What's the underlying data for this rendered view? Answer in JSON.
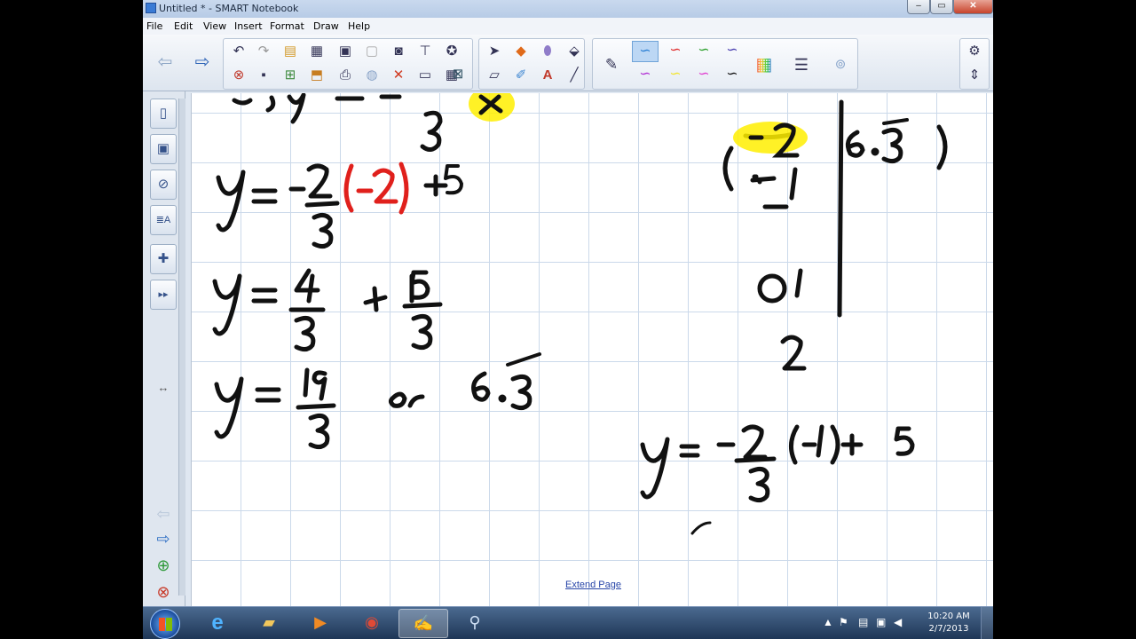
{
  "window": {
    "title": "Untitled * - SMART Notebook"
  },
  "menu": [
    "File",
    "Edit",
    "View",
    "Insert",
    "Format",
    "Draw",
    "Help"
  ],
  "canvas": {
    "extend_page_label": "Extend Page"
  },
  "handwriting": {
    "line1": "y = -2/3 (-2) + 5",
    "line2": "y = 4/3 + 15/3",
    "line3": "y = 19/3 or 6.3̄",
    "table_x": [
      "-2",
      "-1",
      "0",
      "1",
      "2"
    ],
    "table_y_first": "6.3̄",
    "line4": "y = -2/3 (-1) + 5"
  },
  "tray": {
    "time": "10:20 AM",
    "date": "2/7/2013"
  },
  "colors": {
    "highlight": "#ffee00",
    "ink_red": "#e0201c",
    "ink_black": "#111111",
    "grid": "#cbd9ea"
  }
}
